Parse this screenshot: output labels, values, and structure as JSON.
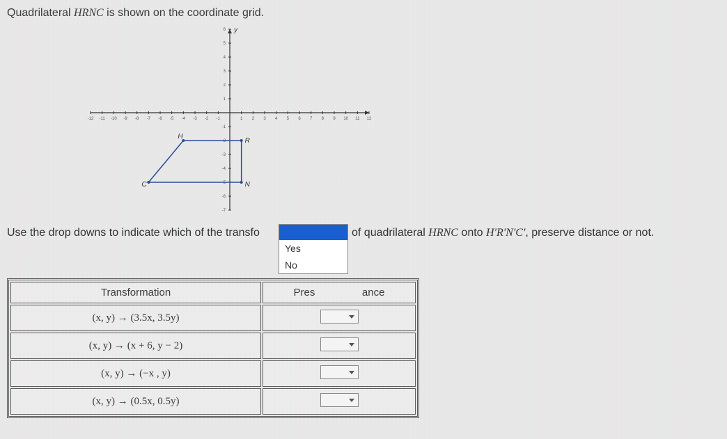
{
  "prompt_top_pre": "Quadrilateral ",
  "prompt_top_math": "HRNC",
  "prompt_top_post": " is shown on the coordinate grid.",
  "graph": {
    "x_min": -12,
    "x_max": 12,
    "y_min": -7,
    "y_max": 6,
    "x_ticks": [
      -12,
      -11,
      -10,
      -9,
      -8,
      -7,
      -6,
      -5,
      -4,
      -3,
      -2,
      -1,
      0,
      1,
      2,
      3,
      4,
      5,
      6,
      7,
      8,
      9,
      10,
      11,
      12
    ],
    "y_ticks": [
      -7,
      -6,
      -5,
      -4,
      -3,
      -2,
      -1,
      0,
      1,
      2,
      3,
      4,
      5,
      6
    ],
    "y_axis_label": "y",
    "points": {
      "H": [
        -4,
        -2
      ],
      "R": [
        1,
        -2
      ],
      "N": [
        1,
        -5
      ],
      "C": [
        -7,
        -5
      ]
    }
  },
  "instruction_left": "Use the drop downs to indicate which of the transfo",
  "instruction_right_pre": "of quadrilateral ",
  "instruction_right_math1": "HRNC",
  "instruction_right_mid": " onto ",
  "instruction_right_math2": "H'R'N'C'",
  "instruction_right_post": ", preserve distance or not.",
  "dropdown": {
    "selected": "",
    "options": [
      "Yes",
      "No"
    ]
  },
  "table": {
    "header_transformation": "Transformation",
    "header_preserve_left": "Pres",
    "header_preserve_right": "ance",
    "rows": [
      {
        "formula": "(x, y) → (3.5x, 3.5y)"
      },
      {
        "formula": "(x, y) → (x + 6, y − 2)"
      },
      {
        "formula": "(x, y) → (−x , y)"
      },
      {
        "formula": "(x, y) → (0.5x, 0.5y)"
      }
    ]
  },
  "chart_data": {
    "type": "scatter",
    "title": "Quadrilateral HRNC on coordinate grid",
    "xlabel": "",
    "ylabel": "y",
    "xlim": [
      -12,
      12
    ],
    "ylim": [
      -7,
      6
    ],
    "series": [
      {
        "name": "H",
        "values": [
          [
            -4,
            -2
          ]
        ]
      },
      {
        "name": "R",
        "values": [
          [
            1,
            -2
          ]
        ]
      },
      {
        "name": "N",
        "values": [
          [
            1,
            -5
          ]
        ]
      },
      {
        "name": "C",
        "values": [
          [
            -7,
            -5
          ]
        ]
      }
    ],
    "shape_edges": [
      [
        "H",
        "R"
      ],
      [
        "R",
        "N"
      ],
      [
        "N",
        "C"
      ],
      [
        "C",
        "H"
      ]
    ]
  }
}
